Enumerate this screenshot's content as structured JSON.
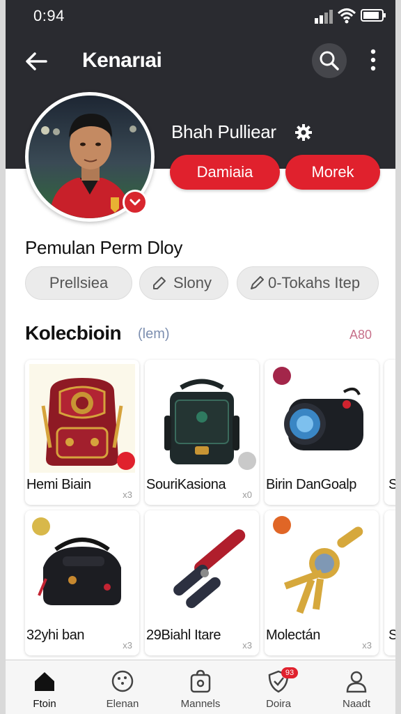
{
  "status_bar": {
    "time": "0:94"
  },
  "header": {
    "title": "Kenarıai"
  },
  "profile": {
    "name": "Bhah Pulliear",
    "buttons": [
      "Damiaia",
      "Morek"
    ]
  },
  "player_section": {
    "title": "Pemulan Perm Dloy",
    "chips": [
      "Prellsiea",
      "Slony",
      "0-Tokahs Itep"
    ]
  },
  "collection": {
    "title": "Kolecbioin",
    "subtitle": "(lem)",
    "count": "A80",
    "items": [
      {
        "label": "Hemi Biain",
        "qty": "x3"
      },
      {
        "label": "SouriKasiona",
        "qty": "x0"
      },
      {
        "label": "Birin DanGoalp",
        "qty": ""
      },
      {
        "label": "S",
        "qty": ""
      },
      {
        "label": "32yhi ban",
        "qty": "x3"
      },
      {
        "label": "29Biahl Itare",
        "qty": "x3"
      },
      {
        "label": "Molectán",
        "qty": "x3"
      },
      {
        "label": "S",
        "qty": ""
      }
    ]
  },
  "bottom_nav": [
    {
      "label": "Ftoin",
      "icon": "home-icon",
      "active": true
    },
    {
      "label": "Elenan",
      "icon": "ball-icon",
      "active": false
    },
    {
      "label": "Mannels",
      "icon": "bag-icon",
      "active": false
    },
    {
      "label": "Doira",
      "icon": "shield-icon",
      "active": false,
      "badge": "93"
    },
    {
      "label": "Naadt",
      "icon": "person-icon",
      "active": false
    }
  ],
  "colors": {
    "accent": "#e0212d",
    "header_bg": "#2a2b30"
  }
}
